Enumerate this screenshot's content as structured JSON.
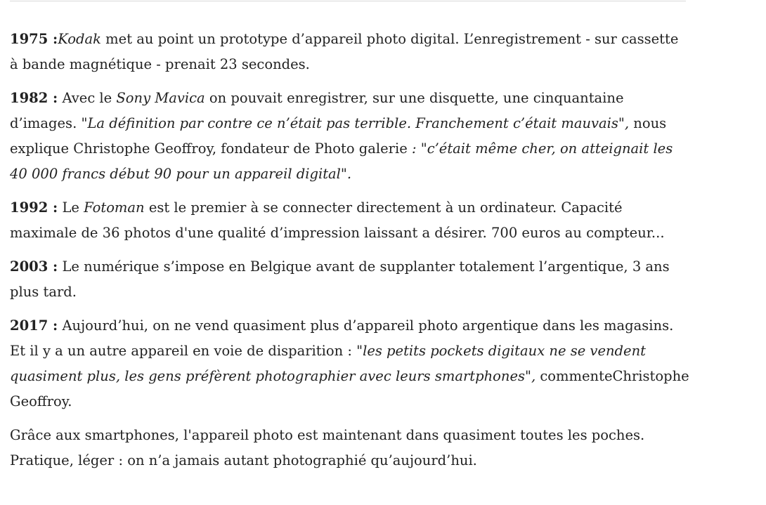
{
  "paragraphs": {
    "p1975": {
      "year": "1975 :",
      "brand": "Kodak",
      "text": " met au point un prototype d’appareil photo digital. L’enregistrement - sur cassette à bande magnétique - prenait 23 secondes."
    },
    "p1982": {
      "year": "1982 :",
      "lead": " Avec le ",
      "product": "Sony Mavica",
      "text1": " on pouvait enregistrer, sur une disquette, une cinquantaine d’images. \"",
      "quote1": "La définition par contre ce n’était pas terrible. Franchement c’était mauvais\",",
      "text2": " nous explique Christophe Geoffroy, fondateur de Photo galerie ",
      "quote2": ": \"c’était même cher, on atteignait les 40 000 francs début 90 pour un appareil digital\"."
    },
    "p1992": {
      "year": "1992 :",
      "lead": " Le ",
      "product": "Fotoman",
      "text": " est le premier à se connecter directement à un ordinateur. Capacité maximale de 36 photos d'une qualité d’impression laissant a désirer. 700 euros au compteur..."
    },
    "p2003": {
      "year": "2003 :",
      "text": " Le numérique s’impose en Belgique avant de supplanter totalement l’argentique, 3 ans plus tard."
    },
    "p2017": {
      "year": "2017 :",
      "text1": " Aujourd’hui, on ne vend quasiment plus d’appareil photo argentique dans les magasins. Et il y a un autre appareil en voie de disparition : \"",
      "quote": "les petits pockets digitaux ne se vendent quasiment plus, les gens préfèrent photographier avec leurs smartphones\",",
      "text2": " commenteChristophe Geoffroy."
    },
    "closing": {
      "text": "Grâce aux smartphones, l'appareil photo est maintenant dans quasiment toutes les poches. Pratique, léger : on n’a jamais autant photographié qu’aujourd’hui."
    }
  }
}
